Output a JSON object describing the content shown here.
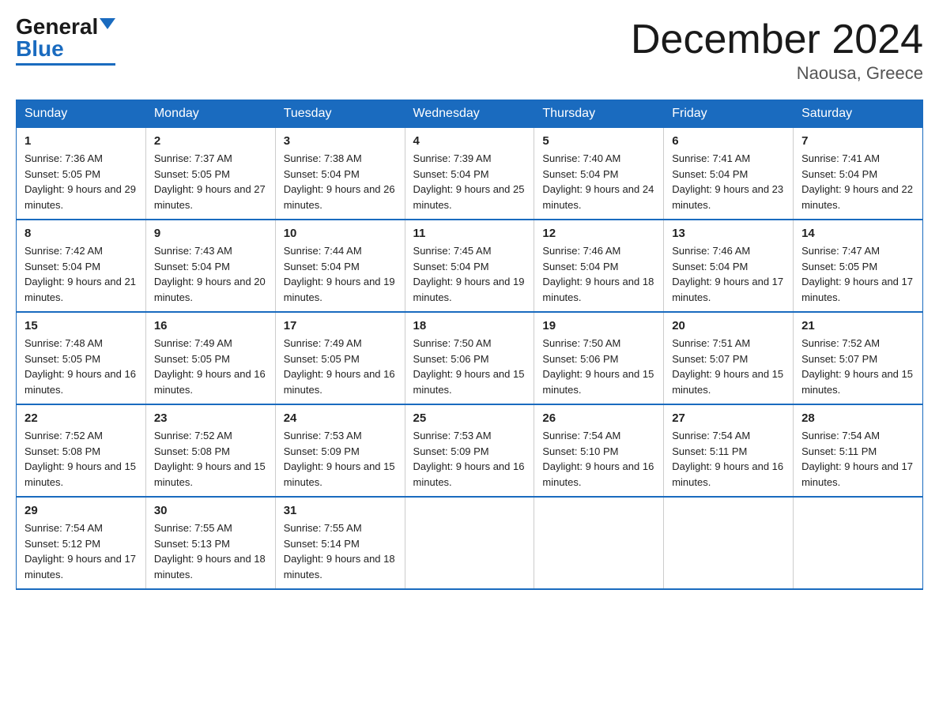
{
  "header": {
    "logo_general": "General",
    "logo_blue": "Blue",
    "month_title": "December 2024",
    "location": "Naousa, Greece"
  },
  "days_of_week": [
    "Sunday",
    "Monday",
    "Tuesday",
    "Wednesday",
    "Thursday",
    "Friday",
    "Saturday"
  ],
  "weeks": [
    [
      {
        "day": "1",
        "sunrise": "7:36 AM",
        "sunset": "5:05 PM",
        "daylight": "9 hours and 29 minutes."
      },
      {
        "day": "2",
        "sunrise": "7:37 AM",
        "sunset": "5:05 PM",
        "daylight": "9 hours and 27 minutes."
      },
      {
        "day": "3",
        "sunrise": "7:38 AM",
        "sunset": "5:04 PM",
        "daylight": "9 hours and 26 minutes."
      },
      {
        "day": "4",
        "sunrise": "7:39 AM",
        "sunset": "5:04 PM",
        "daylight": "9 hours and 25 minutes."
      },
      {
        "day": "5",
        "sunrise": "7:40 AM",
        "sunset": "5:04 PM",
        "daylight": "9 hours and 24 minutes."
      },
      {
        "day": "6",
        "sunrise": "7:41 AM",
        "sunset": "5:04 PM",
        "daylight": "9 hours and 23 minutes."
      },
      {
        "day": "7",
        "sunrise": "7:41 AM",
        "sunset": "5:04 PM",
        "daylight": "9 hours and 22 minutes."
      }
    ],
    [
      {
        "day": "8",
        "sunrise": "7:42 AM",
        "sunset": "5:04 PM",
        "daylight": "9 hours and 21 minutes."
      },
      {
        "day": "9",
        "sunrise": "7:43 AM",
        "sunset": "5:04 PM",
        "daylight": "9 hours and 20 minutes."
      },
      {
        "day": "10",
        "sunrise": "7:44 AM",
        "sunset": "5:04 PM",
        "daylight": "9 hours and 19 minutes."
      },
      {
        "day": "11",
        "sunrise": "7:45 AM",
        "sunset": "5:04 PM",
        "daylight": "9 hours and 19 minutes."
      },
      {
        "day": "12",
        "sunrise": "7:46 AM",
        "sunset": "5:04 PM",
        "daylight": "9 hours and 18 minutes."
      },
      {
        "day": "13",
        "sunrise": "7:46 AM",
        "sunset": "5:04 PM",
        "daylight": "9 hours and 17 minutes."
      },
      {
        "day": "14",
        "sunrise": "7:47 AM",
        "sunset": "5:05 PM",
        "daylight": "9 hours and 17 minutes."
      }
    ],
    [
      {
        "day": "15",
        "sunrise": "7:48 AM",
        "sunset": "5:05 PM",
        "daylight": "9 hours and 16 minutes."
      },
      {
        "day": "16",
        "sunrise": "7:49 AM",
        "sunset": "5:05 PM",
        "daylight": "9 hours and 16 minutes."
      },
      {
        "day": "17",
        "sunrise": "7:49 AM",
        "sunset": "5:05 PM",
        "daylight": "9 hours and 16 minutes."
      },
      {
        "day": "18",
        "sunrise": "7:50 AM",
        "sunset": "5:06 PM",
        "daylight": "9 hours and 15 minutes."
      },
      {
        "day": "19",
        "sunrise": "7:50 AM",
        "sunset": "5:06 PM",
        "daylight": "9 hours and 15 minutes."
      },
      {
        "day": "20",
        "sunrise": "7:51 AM",
        "sunset": "5:07 PM",
        "daylight": "9 hours and 15 minutes."
      },
      {
        "day": "21",
        "sunrise": "7:52 AM",
        "sunset": "5:07 PM",
        "daylight": "9 hours and 15 minutes."
      }
    ],
    [
      {
        "day": "22",
        "sunrise": "7:52 AM",
        "sunset": "5:08 PM",
        "daylight": "9 hours and 15 minutes."
      },
      {
        "day": "23",
        "sunrise": "7:52 AM",
        "sunset": "5:08 PM",
        "daylight": "9 hours and 15 minutes."
      },
      {
        "day": "24",
        "sunrise": "7:53 AM",
        "sunset": "5:09 PM",
        "daylight": "9 hours and 15 minutes."
      },
      {
        "day": "25",
        "sunrise": "7:53 AM",
        "sunset": "5:09 PM",
        "daylight": "9 hours and 16 minutes."
      },
      {
        "day": "26",
        "sunrise": "7:54 AM",
        "sunset": "5:10 PM",
        "daylight": "9 hours and 16 minutes."
      },
      {
        "day": "27",
        "sunrise": "7:54 AM",
        "sunset": "5:11 PM",
        "daylight": "9 hours and 16 minutes."
      },
      {
        "day": "28",
        "sunrise": "7:54 AM",
        "sunset": "5:11 PM",
        "daylight": "9 hours and 17 minutes."
      }
    ],
    [
      {
        "day": "29",
        "sunrise": "7:54 AM",
        "sunset": "5:12 PM",
        "daylight": "9 hours and 17 minutes."
      },
      {
        "day": "30",
        "sunrise": "7:55 AM",
        "sunset": "5:13 PM",
        "daylight": "9 hours and 18 minutes."
      },
      {
        "day": "31",
        "sunrise": "7:55 AM",
        "sunset": "5:14 PM",
        "daylight": "9 hours and 18 minutes."
      },
      null,
      null,
      null,
      null
    ]
  ]
}
